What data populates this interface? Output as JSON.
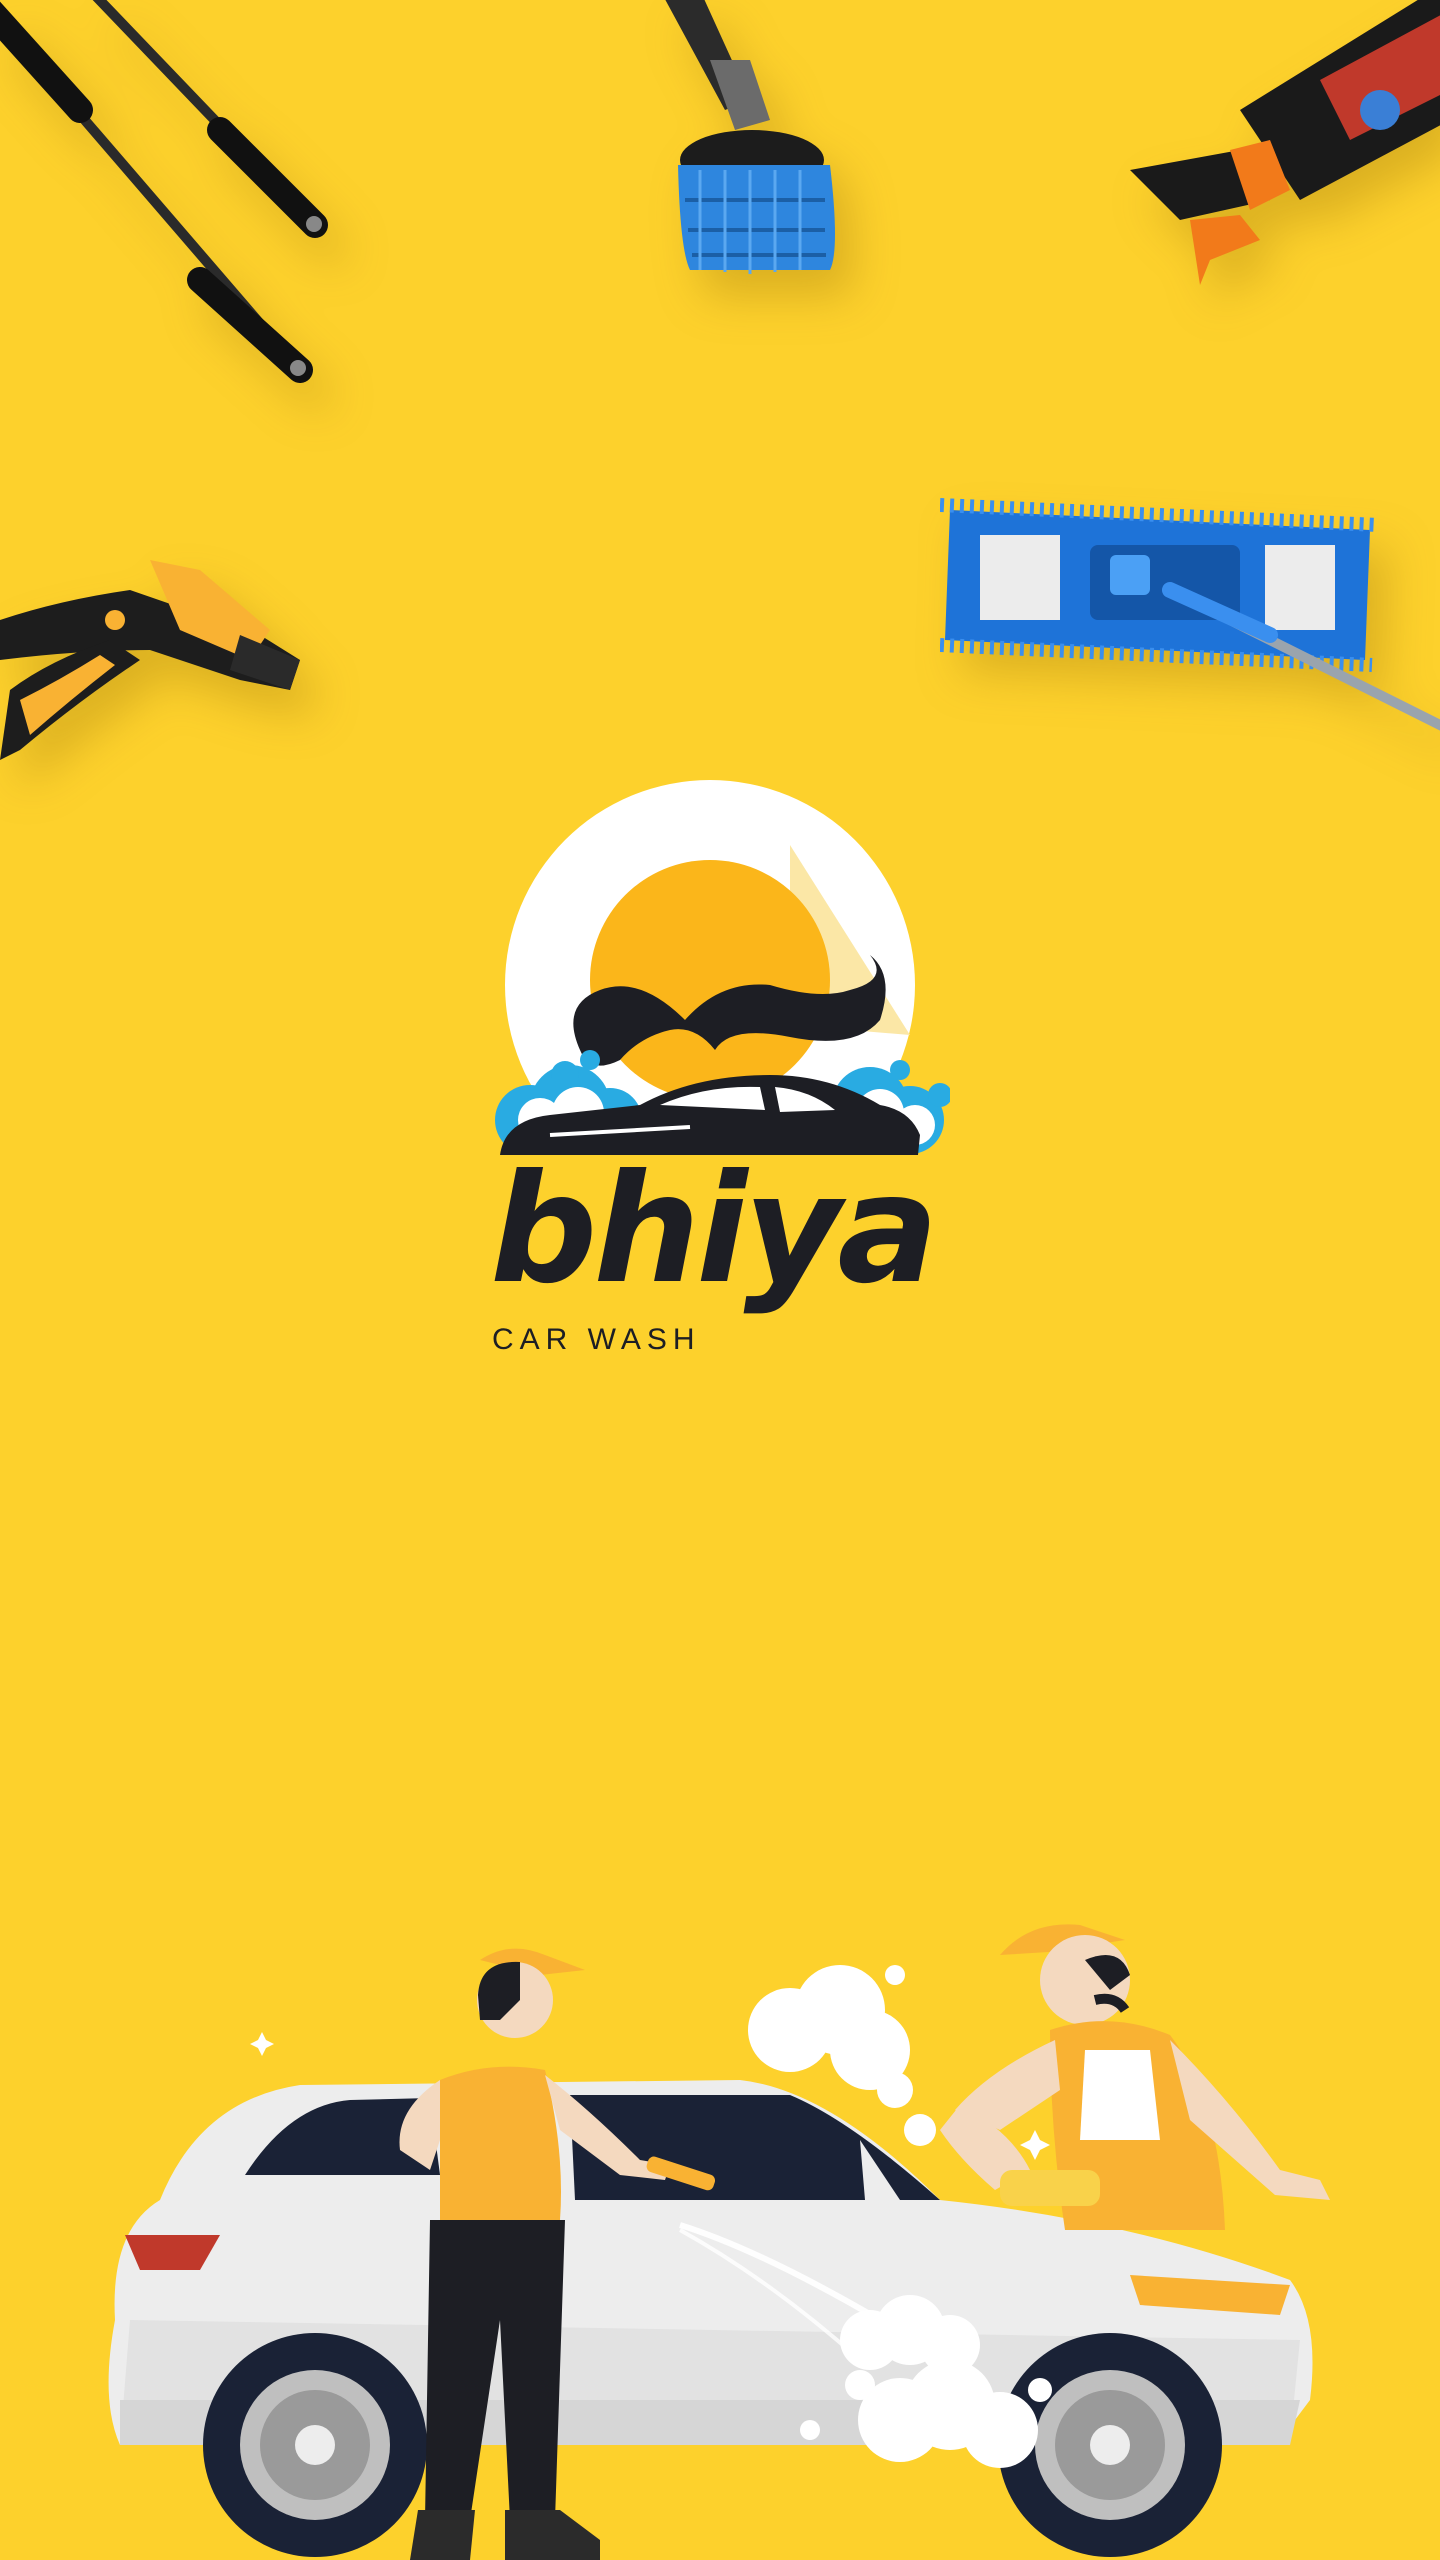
{
  "app": {
    "brand_name": "bhiya",
    "brand_tagline": "CAR WASH"
  },
  "colors": {
    "background": "#FDD12C",
    "logo_sun": "#FBB61A",
    "logo_bubbles": "#29ABE2",
    "dark": "#1D1E24"
  },
  "decorations": {
    "tools": [
      "pressure-wand-icon",
      "wheel-brush-icon",
      "spray-bottle-icon",
      "hose-nozzle-icon",
      "microfiber-mop-icon"
    ],
    "illustration": "car-wash-workers-illustration"
  }
}
